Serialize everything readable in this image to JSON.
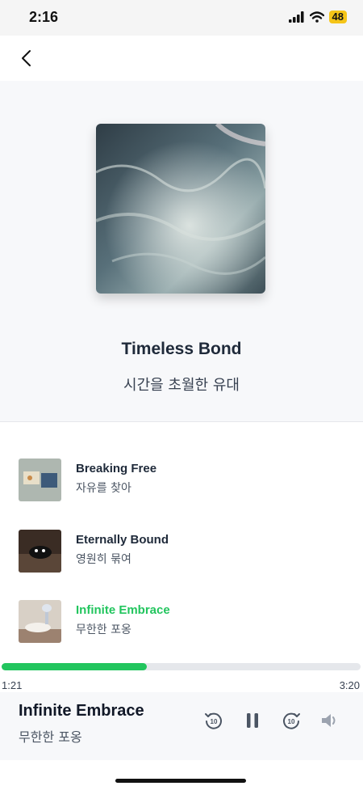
{
  "status_bar": {
    "time": "2:16",
    "battery": "48"
  },
  "album": {
    "title": "Timeless Bond",
    "subtitle": "시간을 초월한 유대"
  },
  "tracks": [
    {
      "title": "Breaking Free",
      "subtitle": "자유를 찾아",
      "active": false
    },
    {
      "title": "Eternally Bound",
      "subtitle": "영원히 묶여",
      "active": false
    },
    {
      "title": "Infinite Embrace",
      "subtitle": "무한한 포옹",
      "active": true
    }
  ],
  "player": {
    "elapsed": "1:21",
    "total": "3:20",
    "progress": 0.405,
    "title": "Infinite Embrace",
    "subtitle": "무한한 포옹",
    "rewind_label": "10",
    "forward_label": "10"
  },
  "colors": {
    "accent": "#22c55e",
    "icon": "#4b5563"
  },
  "icons": [
    "chevron-left-icon",
    "signal-icon",
    "wifi-icon",
    "battery-icon",
    "rewind-10-icon",
    "pause-icon",
    "forward-10-icon",
    "volume-icon"
  ]
}
